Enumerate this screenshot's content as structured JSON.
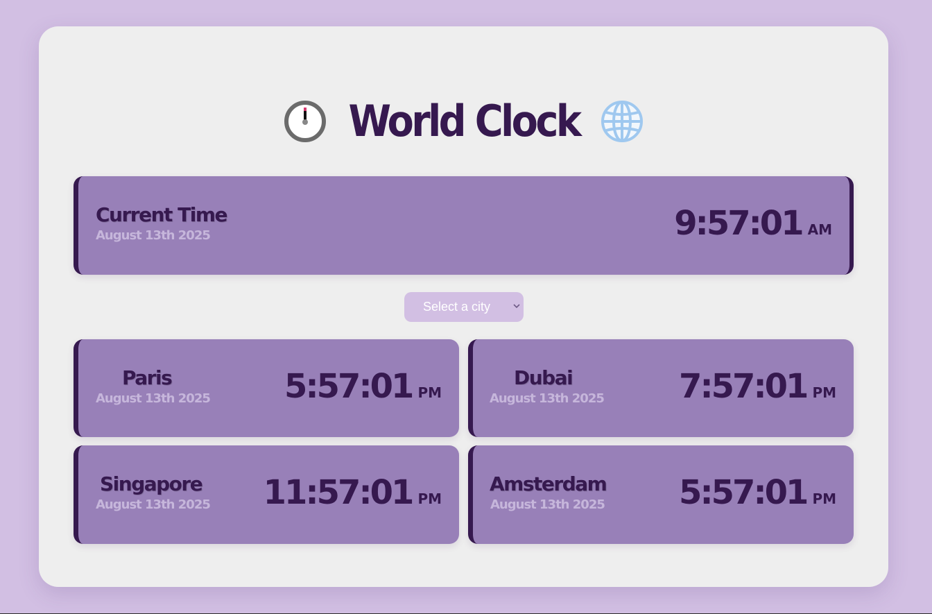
{
  "header": {
    "title": "World Clock",
    "left_icon": "stopwatch-icon",
    "right_icon": "globe-icon"
  },
  "current": {
    "label": "Current Time",
    "date": "August 13th 2025",
    "time": "9:57:01",
    "ampm": "AM"
  },
  "city_select": {
    "placeholder": "Select a city"
  },
  "cities": [
    {
      "name": "Paris",
      "date": "August 13th 2025",
      "time": "5:57:01",
      "ampm": "PM"
    },
    {
      "name": "Dubai",
      "date": "August 13th 2025",
      "time": "7:57:01",
      "ampm": "PM"
    },
    {
      "name": "Singapore",
      "date": "August 13th 2025",
      "time": "11:57:01",
      "ampm": "PM"
    },
    {
      "name": "Amsterdam",
      "date": "August 13th 2025",
      "time": "5:57:01",
      "ampm": "PM"
    }
  ],
  "colors": {
    "background": "#d2bfe3",
    "panel": "#eeeeee",
    "card": "#9880b8",
    "accent": "#36194f",
    "date_text": "#c6b6db"
  }
}
